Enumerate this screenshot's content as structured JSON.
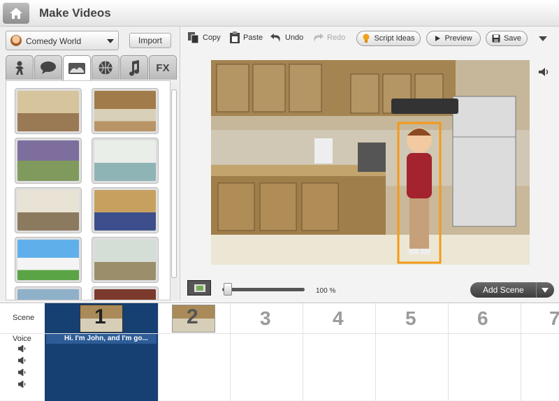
{
  "header": {
    "title": "Make Videos",
    "home_icon": "home-icon"
  },
  "left_panel": {
    "theme_selector": {
      "selected": "Comedy World",
      "icon": "comedy-world-icon"
    },
    "import_label": "Import",
    "category_tabs": [
      {
        "name": "characters",
        "icon": "character-icon"
      },
      {
        "name": "dialogue",
        "icon": "speech-bubble-icon"
      },
      {
        "name": "backgrounds",
        "icon": "background-icon"
      },
      {
        "name": "props",
        "icon": "ball-icon"
      },
      {
        "name": "music",
        "icon": "music-note-icon"
      },
      {
        "name": "effects",
        "icon": "fx-icon",
        "label": "FX"
      }
    ],
    "selected_tab": "backgrounds",
    "backgrounds": [
      {
        "name": "bedroom",
        "color": "#b89a72"
      },
      {
        "name": "kitchen",
        "color": "#b08a58"
      },
      {
        "name": "living-room",
        "color": "#8f9a78"
      },
      {
        "name": "modern-kitchen",
        "color": "#cfd8d6"
      },
      {
        "name": "office",
        "color": "#c9c4b4"
      },
      {
        "name": "oval-office",
        "color": "#9c8b6c"
      },
      {
        "name": "white-house",
        "color": "#6fb5e4"
      },
      {
        "name": "train-station",
        "color": "#b4bfb3"
      },
      {
        "name": "city-view",
        "color": "#8fb0c9"
      },
      {
        "name": "theater",
        "color": "#7c3a2c"
      }
    ]
  },
  "toolbar": {
    "copy_label": "Copy",
    "paste_label": "Paste",
    "undo_label": "Undo",
    "redo_label": "Redo",
    "script_ideas_label": "Script Ideas",
    "preview_label": "Preview",
    "save_label": "Save"
  },
  "stage": {
    "selection_tools": [
      "flip-icon",
      "bring-front-icon",
      "send-back-icon",
      "delete-icon"
    ]
  },
  "zoom": {
    "value": "100 %"
  },
  "add_scene_label": "Add Scene",
  "timeline": {
    "scene_label": "Scene",
    "voice_label": "Voice",
    "scenes": [
      "1",
      "2",
      "3",
      "4",
      "5",
      "6",
      "7"
    ],
    "voice_line": "Hi. I'm John, and I'm go..."
  }
}
